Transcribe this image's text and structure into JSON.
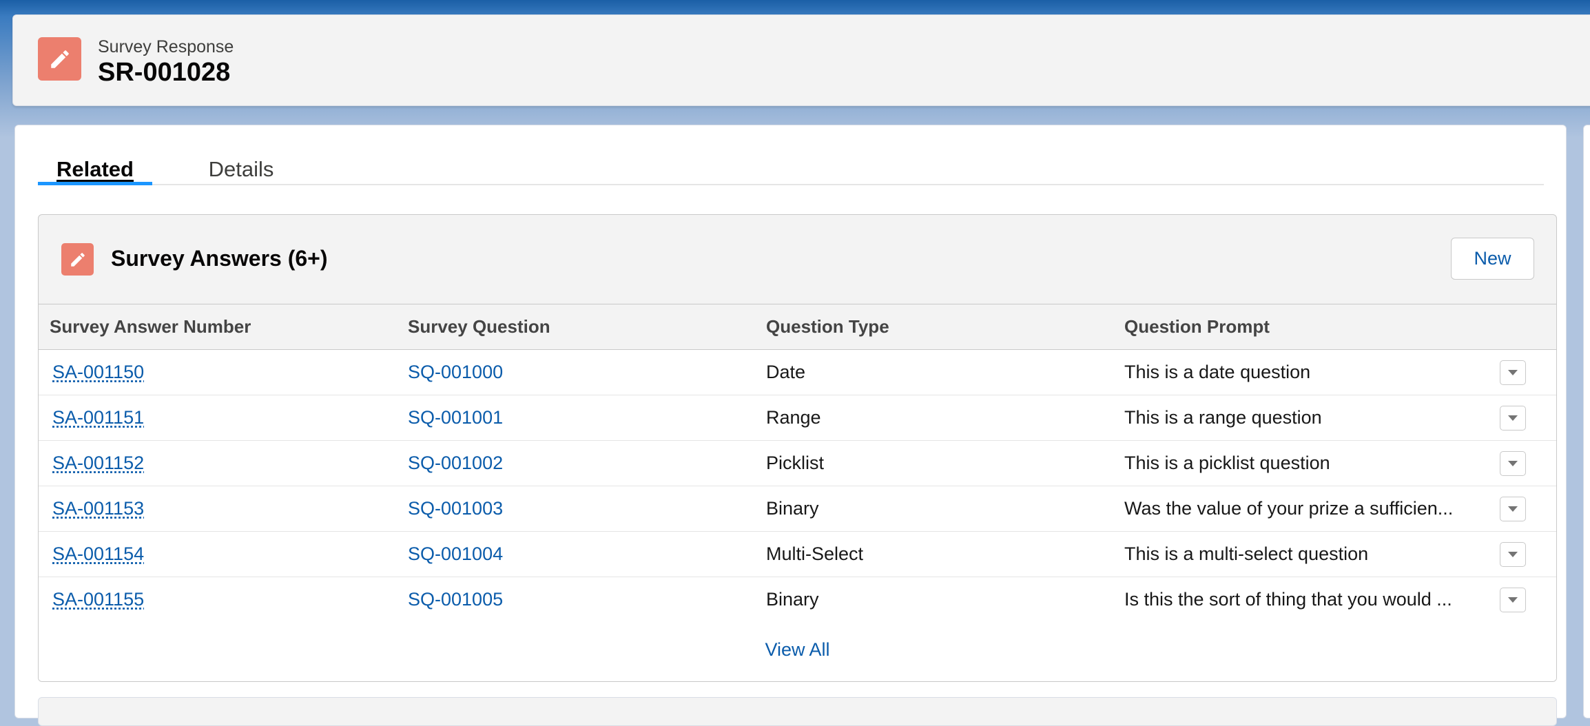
{
  "header": {
    "object_label": "Survey Response",
    "record_name": "SR-001028",
    "icon": "edit-pencil-icon"
  },
  "tabs": [
    {
      "label": "Related",
      "active": true
    },
    {
      "label": "Details",
      "active": false
    }
  ],
  "related_list": {
    "title": "Survey Answers (6+)",
    "icon": "edit-pencil-icon",
    "new_button_label": "New",
    "columns": [
      "Survey Answer Number",
      "Survey Question",
      "Question Type",
      "Question Prompt"
    ],
    "rows": [
      {
        "number": "SA-001150",
        "question": "SQ-001000",
        "type": "Date",
        "prompt": "This is a date question"
      },
      {
        "number": "SA-001151",
        "question": "SQ-001001",
        "type": "Range",
        "prompt": "This is a range question"
      },
      {
        "number": "SA-001152",
        "question": "SQ-001002",
        "type": "Picklist",
        "prompt": "This is a picklist question"
      },
      {
        "number": "SA-001153",
        "question": "SQ-001003",
        "type": "Binary",
        "prompt": "Was the value of your prize a sufficien..."
      },
      {
        "number": "SA-001154",
        "question": "SQ-001004",
        "type": "Multi-Select",
        "prompt": "This is a multi-select question"
      },
      {
        "number": "SA-001155",
        "question": "SQ-001005",
        "type": "Binary",
        "prompt": "Is this the sort of thing that you would ..."
      }
    ],
    "view_all_label": "View All"
  },
  "colors": {
    "accent": "#1b96ff",
    "link": "#0b5cab",
    "icon_bg": "#ec7f6e"
  }
}
